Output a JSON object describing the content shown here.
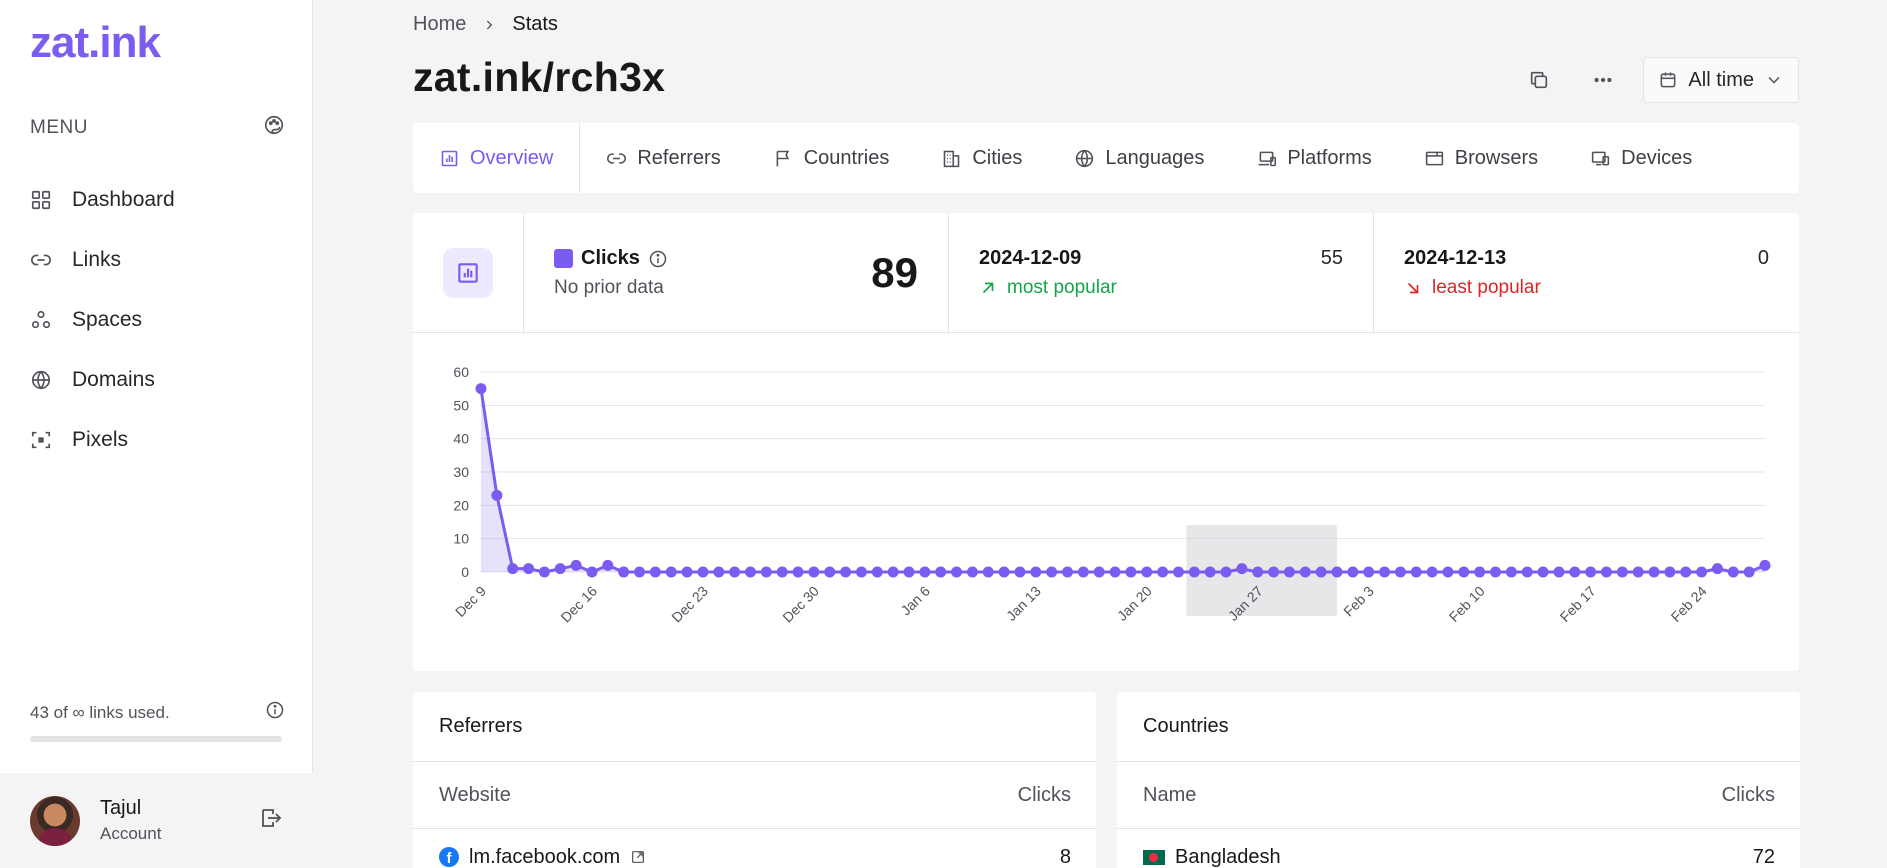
{
  "app": {
    "logo": "zat.ink"
  },
  "sidebar": {
    "menu_label": "MENU",
    "items": [
      {
        "label": "Dashboard",
        "icon": "grid-icon"
      },
      {
        "label": "Links",
        "icon": "link-icon"
      },
      {
        "label": "Spaces",
        "icon": "spaces-icon"
      },
      {
        "label": "Domains",
        "icon": "globe-www-icon"
      },
      {
        "label": "Pixels",
        "icon": "pixel-scan-icon"
      }
    ],
    "usage_text": "43 of ∞ links used.",
    "account": {
      "name": "Tajul",
      "subtitle": "Account"
    }
  },
  "breadcrumb": {
    "home": "Home",
    "current": "Stats"
  },
  "page": {
    "title": "zat.ink/rch3x"
  },
  "actions": {
    "range_label": "All time"
  },
  "tabs": [
    {
      "label": "Overview",
      "active": true
    },
    {
      "label": "Referrers"
    },
    {
      "label": "Countries"
    },
    {
      "label": "Cities"
    },
    {
      "label": "Languages"
    },
    {
      "label": "Platforms"
    },
    {
      "label": "Browsers"
    },
    {
      "label": "Devices"
    }
  ],
  "kpis": {
    "clicks_label": "Clicks",
    "clicks_sub": "No prior data",
    "clicks_total": "89",
    "most_popular": {
      "date": "2024-12-09",
      "value": "55",
      "label": "most popular"
    },
    "least_popular": {
      "date": "2024-12-13",
      "value": "0",
      "label": "least popular"
    }
  },
  "colors": {
    "accent": "#7c5cf0",
    "up": "#16a34a",
    "down": "#dc2626"
  },
  "chart_data": {
    "type": "area",
    "ylim": [
      0,
      60
    ],
    "yticks": [
      0,
      10,
      20,
      30,
      40,
      50,
      60
    ],
    "xtick_labels": [
      "Dec 9",
      "Dec 16",
      "Dec 23",
      "Dec 30",
      "Jan 6",
      "Jan 13",
      "Jan 20",
      "Jan 27",
      "Feb 3",
      "Feb 10",
      "Feb 17",
      "Feb 24"
    ],
    "series": [
      {
        "values": [
          55,
          23,
          1,
          1,
          0,
          1,
          2,
          0,
          2,
          0,
          0,
          0,
          0,
          0,
          0,
          0,
          0,
          0,
          0,
          0,
          0,
          0,
          0,
          0,
          0,
          0,
          0,
          0,
          0,
          0,
          0,
          0,
          0,
          0,
          0,
          0,
          0,
          0,
          0,
          0,
          0,
          0,
          0,
          0,
          0,
          0,
          0,
          0,
          1,
          0,
          0,
          0,
          0,
          0,
          0,
          0,
          0,
          0,
          0,
          0,
          0,
          0,
          0,
          0,
          0,
          0,
          0,
          0,
          0,
          0,
          0,
          0,
          0,
          0,
          0,
          0,
          0,
          0,
          1,
          0,
          0,
          2
        ]
      }
    ]
  },
  "referrers_panel": {
    "title": "Referrers",
    "col_name": "Website",
    "col_value": "Clicks",
    "rows": [
      {
        "name": "lm.facebook.com",
        "value": "8"
      }
    ]
  },
  "countries_panel": {
    "title": "Countries",
    "col_name": "Name",
    "col_value": "Clicks",
    "rows": [
      {
        "name": "Bangladesh",
        "value": "72"
      }
    ]
  }
}
